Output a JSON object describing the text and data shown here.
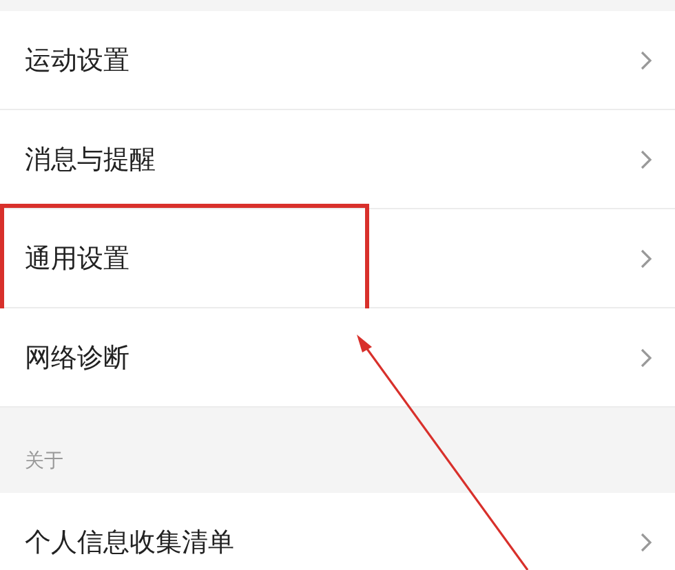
{
  "groups": [
    {
      "items": [
        {
          "label": "运动设置",
          "highlighted": false
        },
        {
          "label": "消息与提醒",
          "highlighted": false
        },
        {
          "label": "通用设置",
          "highlighted": true
        },
        {
          "label": "网络诊断",
          "highlighted": false
        }
      ]
    },
    {
      "header": "关于",
      "items": [
        {
          "label": "个人信息收集清单",
          "highlighted": false
        }
      ]
    }
  ]
}
